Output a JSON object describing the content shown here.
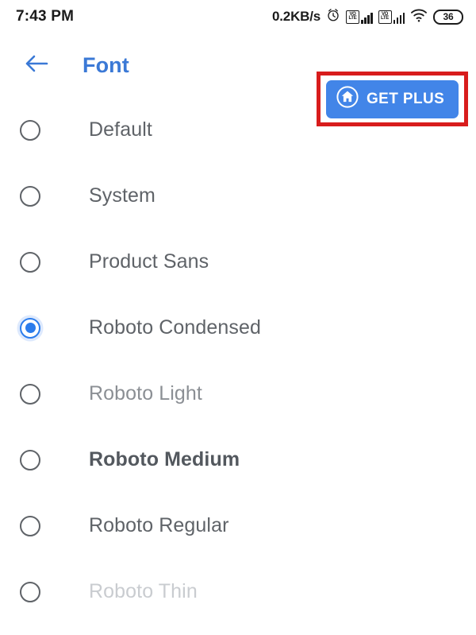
{
  "status_bar": {
    "clock": "7:43 PM",
    "network_speed": "0.2KB/s",
    "alarm_icon": "alarm-clock-icon",
    "volte_top": "VO",
    "volte_bottom": "LTE",
    "sim1_signal_icon": "signal-bars-icon",
    "sim2_signal_icon": "signal-bars-icon",
    "wifi_icon": "wifi-icon",
    "battery_level": "36"
  },
  "app_bar": {
    "back_icon": "back-arrow-icon",
    "title": "Font",
    "title_color": "#3b79d6"
  },
  "get_plus": {
    "label": "GET PLUS",
    "home_icon": "home-circle-icon",
    "button_color": "#4285e8",
    "highlight_color": "#d81c1c"
  },
  "font_list": {
    "items": [
      {
        "label": "Default",
        "selected": false,
        "style": "w-regular"
      },
      {
        "label": "System",
        "selected": false,
        "style": "w-regular"
      },
      {
        "label": "Product Sans",
        "selected": false,
        "style": "w-regular"
      },
      {
        "label": "Roboto Condensed",
        "selected": true,
        "style": "w-regular"
      },
      {
        "label": "Roboto Light",
        "selected": false,
        "style": "w-light"
      },
      {
        "label": "Roboto Medium",
        "selected": false,
        "style": "w-medium"
      },
      {
        "label": "Roboto Regular",
        "selected": false,
        "style": "w-regular"
      },
      {
        "label": "Roboto Thin",
        "selected": false,
        "style": "w-thin"
      }
    ],
    "selected_value": "Roboto Condensed",
    "accent_color": "#2b7cec"
  }
}
